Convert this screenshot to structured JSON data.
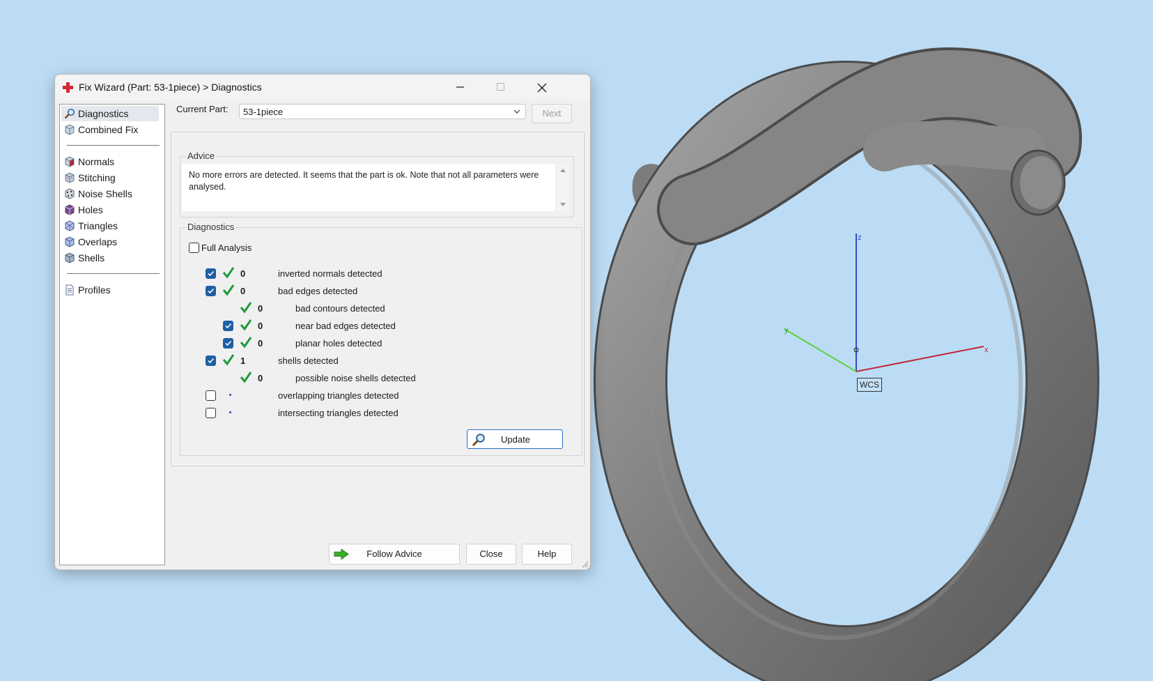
{
  "window": {
    "title": "Fix Wizard (Part: 53-1piece) > Diagnostics"
  },
  "sidebar": {
    "items": [
      {
        "label": "Diagnostics",
        "icon": "magnifier-icon",
        "selected": true
      },
      {
        "label": "Combined Fix",
        "icon": "cube-icon"
      },
      {
        "label": "Normals",
        "icon": "normals-cube-icon"
      },
      {
        "label": "Stitching",
        "icon": "stitching-cube-icon"
      },
      {
        "label": "Noise Shells",
        "icon": "noise-shells-icon"
      },
      {
        "label": "Holes",
        "icon": "holes-cube-icon"
      },
      {
        "label": "Triangles",
        "icon": "triangles-cube-icon"
      },
      {
        "label": "Overlaps",
        "icon": "overlaps-cube-icon"
      },
      {
        "label": "Shells",
        "icon": "shells-cube-icon"
      },
      {
        "label": "Profiles",
        "icon": "document-icon"
      }
    ]
  },
  "header": {
    "current_part_label": "Current Part:",
    "current_part_value": "53-1piece",
    "next_label": "Next"
  },
  "advice": {
    "title": "Advice",
    "text": "No more errors are detected. It seems that the part is ok. Note that not all parameters were analysed."
  },
  "diagnostics": {
    "title": "Diagnostics",
    "full_analysis_label": "Full Analysis",
    "full_analysis_checked": false,
    "rows": [
      {
        "checkbox": true,
        "checked": true,
        "status": "ok",
        "count": "0",
        "label": "inverted normals detected",
        "indent": 0
      },
      {
        "checkbox": true,
        "checked": true,
        "status": "ok",
        "count": "0",
        "label": "bad edges detected",
        "indent": 0
      },
      {
        "checkbox": false,
        "checked": false,
        "status": "ok",
        "count": "0",
        "label": "bad contours detected",
        "indent": 1
      },
      {
        "checkbox": true,
        "checked": true,
        "status": "ok",
        "count": "0",
        "label": "near bad edges detected",
        "indent": 1
      },
      {
        "checkbox": true,
        "checked": true,
        "status": "ok",
        "count": "0",
        "label": "planar holes detected",
        "indent": 1
      },
      {
        "checkbox": true,
        "checked": true,
        "status": "ok",
        "count": "1",
        "label": "shells detected",
        "indent": 0
      },
      {
        "checkbox": false,
        "checked": false,
        "status": "ok",
        "count": "0",
        "label": "possible noise shells detected",
        "indent": 1
      },
      {
        "checkbox": true,
        "checked": false,
        "status": "none",
        "count": "",
        "label": "overlapping triangles detected",
        "indent": 0
      },
      {
        "checkbox": true,
        "checked": false,
        "status": "none",
        "count": "",
        "label": "intersecting triangles detected",
        "indent": 0
      }
    ],
    "update_label": "Update"
  },
  "footer": {
    "follow_advice_label": "Follow Advice",
    "close_label": "Close",
    "help_label": "Help"
  },
  "viewport": {
    "axis_x": "x",
    "axis_y": "y",
    "axis_z": "z",
    "wcs_label": "WCS",
    "colors": {
      "background": "#bcdcf5",
      "x_axis": "#c0283a",
      "y_axis": "#5ed13a",
      "z_axis": "#2c4fbf",
      "model": "#7a7a7a"
    }
  }
}
